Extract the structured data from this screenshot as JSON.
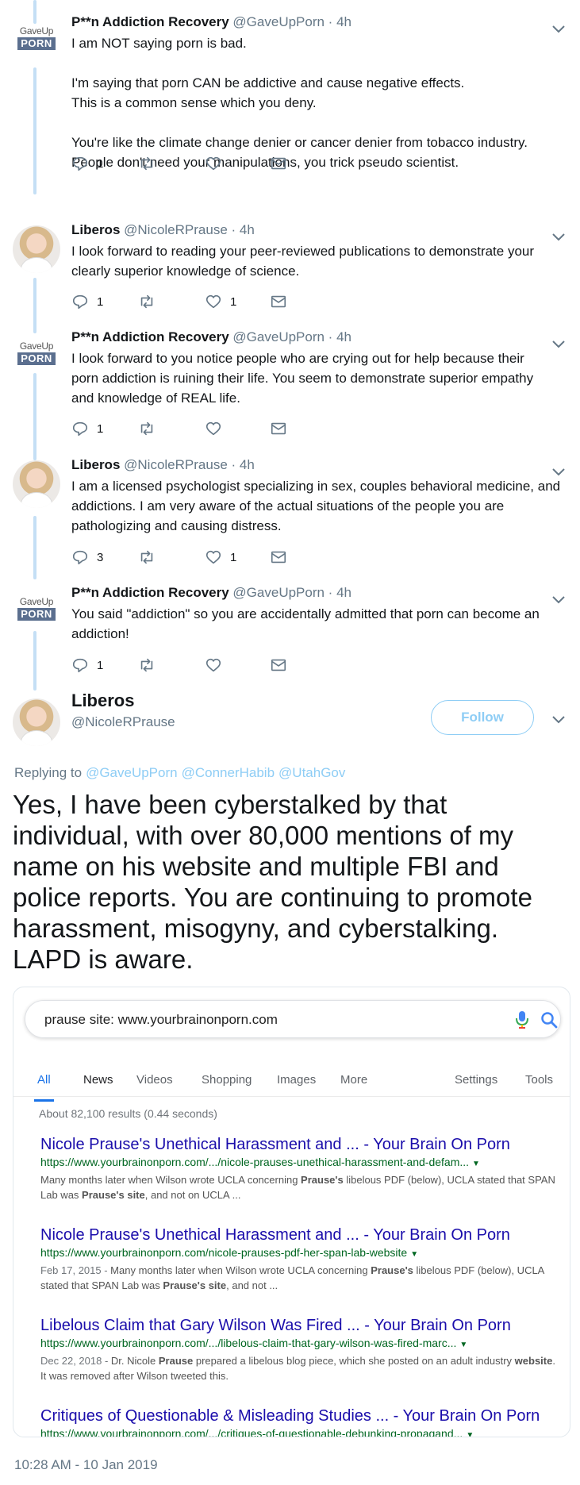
{
  "colors": {
    "text": "#14171a",
    "muted": "#657786",
    "link": "#8ecdf5",
    "thread_line": "#c4dff5",
    "google_blue": "#1a73e8",
    "google_title": "#1a0dab",
    "google_url": "#006621"
  },
  "icons": {
    "reply": "reply-icon",
    "retweet": "retweet-icon",
    "like": "heart-icon",
    "dm": "envelope-icon",
    "more": "chevron-down-icon",
    "mic": "microphone-icon",
    "search": "search-icon"
  },
  "avatar_logo": {
    "top": "GaveUp",
    "box": "PORN"
  },
  "tweets": [
    {
      "name": "P**n Addiction Recovery",
      "meta": "@GaveUpPorn · 4h",
      "lines": [
        "I am NOT saying porn is bad.",
        "",
        "I'm saying that porn CAN be addictive and cause negative effects.",
        "This is a common sense which you deny.",
        "",
        "You're like the climate change denier or cancer denier from tobacco industry.",
        "People don't need your manipulations, you trick pseudo scientist."
      ],
      "replies": "1",
      "retweets": "",
      "likes": ""
    },
    {
      "name": "Liberos",
      "meta": "@NicoleRPrause · 4h",
      "lines": [
        "I look forward to reading your peer-reviewed publications to demonstrate your",
        "clearly superior knowledge of science."
      ],
      "replies": "1",
      "retweets": "",
      "likes": "1"
    },
    {
      "name": "P**n Addiction Recovery",
      "meta": "@GaveUpPorn · 4h",
      "lines": [
        "I look forward to you notice people who are crying out for help because their",
        "porn addiction is ruining their life. You seem to demonstrate superior empathy",
        "and knowledge of REAL life."
      ],
      "replies": "1",
      "retweets": "",
      "likes": ""
    },
    {
      "name": "Liberos",
      "meta": "@NicoleRPrause · 4h",
      "lines": [
        "I am a licensed psychologist specializing in sex, couples behavioral medicine, and",
        "addictions. I am very aware of the actual situations of the people you are",
        "pathologizing and causing distress."
      ],
      "replies": "3",
      "retweets": "",
      "likes": "1"
    },
    {
      "name": "P**n Addiction Recovery",
      "meta": "@GaveUpPorn · 4h",
      "lines": [
        "You said \"addiction\" so you are accidentally admitted that porn can become an",
        "addiction!"
      ],
      "replies": "1",
      "retweets": "",
      "likes": ""
    }
  ],
  "main": {
    "name": "Liberos",
    "handle": "@NicoleRPrause",
    "follow_label": "Follow",
    "replying_label": "Replying to",
    "mentions": [
      "@GaveUpPorn",
      "@ConnerHabib",
      "@UtahGov"
    ],
    "text_lines": [
      "Yes, I have been cyberstalked by that",
      "individual, with over 80,000 mentions of my",
      "name on his website and multiple FBI and",
      "police reports. You are continuing to promote",
      "harassment, misogyny, and cyberstalking.",
      "LAPD is aware."
    ],
    "timestamp": "10:28 AM - 10 Jan 2019"
  },
  "google": {
    "query": "prause site: www.yourbrainonporn.com",
    "tabs": [
      "All",
      "News",
      "Videos",
      "Shopping",
      "Images",
      "More"
    ],
    "tools": [
      "Settings",
      "Tools"
    ],
    "active_tab": "All",
    "stats": "About 82,100 results (0.44 seconds)",
    "results": [
      {
        "title": "Nicole Prause's Unethical Harassment and ... - Your Brain On Porn",
        "url": "https://www.yourbrainonporn.com/.../nicole-prauses-unethical-harassment-and-defam...",
        "date": "",
        "snippet": [
          [
            "Many months later when Wilson wrote UCLA concerning ",
            ""
          ],
          [
            "Prause's",
            "b"
          ],
          [
            " libelous PDF (below), UCLA stated that SPAN Lab was ",
            ""
          ],
          [
            "Prause's site",
            "b"
          ],
          [
            ", and not on UCLA ...",
            ""
          ]
        ]
      },
      {
        "title": "Nicole Prause's Unethical Harassment and ... - Your Brain On Porn",
        "url": "https://www.yourbrainonporn.com/nicole-prauses-pdf-her-span-lab-website",
        "date": "Feb 17, 2015 - ",
        "snippet": [
          [
            "Many months later when Wilson wrote UCLA concerning ",
            ""
          ],
          [
            "Prause's",
            "b"
          ],
          [
            " libelous PDF (below), UCLA stated that SPAN Lab was ",
            ""
          ],
          [
            "Prause's site",
            "b"
          ],
          [
            ", and not ...",
            ""
          ]
        ]
      },
      {
        "title": "Libelous Claim that Gary Wilson Was Fired ... - Your Brain On Porn",
        "url": "https://www.yourbrainonporn.com/.../libelous-claim-that-gary-wilson-was-fired-marc...",
        "date": "Dec 22, 2018 - ",
        "snippet": [
          [
            "Dr. Nicole ",
            ""
          ],
          [
            "Prause",
            "b"
          ],
          [
            " prepared a libelous blog piece, which she posted on an adult industry ",
            ""
          ],
          [
            "website",
            "b"
          ],
          [
            ". It was removed after Wilson tweeted this.",
            ""
          ]
        ]
      },
      {
        "title": "Critiques of Questionable & Misleading Studies ... - Your Brain On Porn",
        "url": "https://www.yourbrainonporn.com/.../critiques-of-questionable-debunking-propagand...",
        "date": "",
        "snippet": []
      }
    ]
  }
}
